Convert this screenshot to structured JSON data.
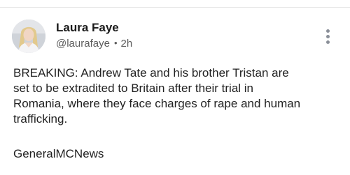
{
  "post": {
    "author": {
      "name": "Laura Faye",
      "handle": "@laurafaye",
      "time": "2h"
    },
    "body_lines": [
      "BREAKING: Andrew Tate and his brother Tristan are",
      "set to be extradited to Britain after their trial in",
      "Romania, where they face charges of rape and human",
      "trafficking."
    ],
    "source": "GeneralMCNews",
    "more_icon": "more-vertical-icon"
  },
  "colors": {
    "text": "#222222",
    "secondary_text": "#5c5c5c",
    "icon": "#8a8f98",
    "divider": "#e6e6e6"
  }
}
